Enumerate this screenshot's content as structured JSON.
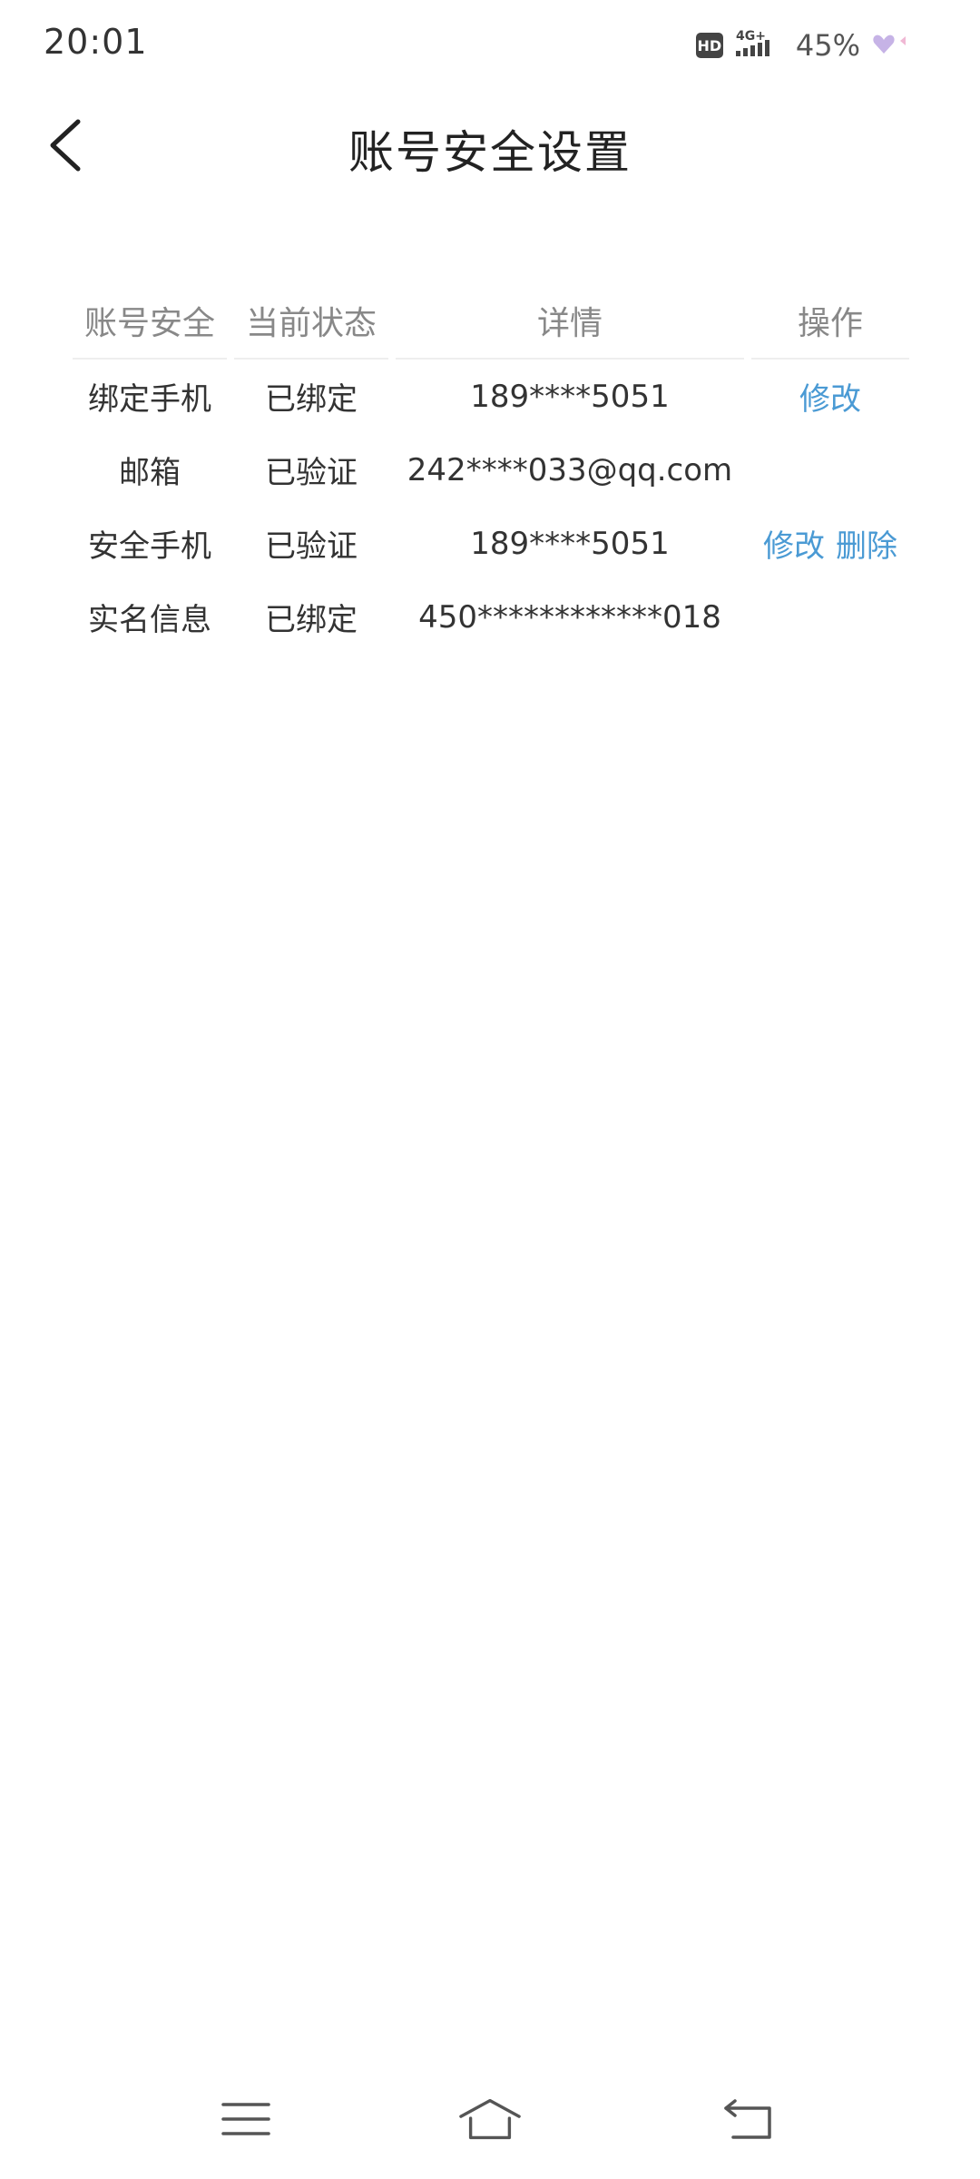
{
  "status_bar": {
    "time": "20:01",
    "hd_label": "HD",
    "network_label": "4G+",
    "battery": "45%"
  },
  "header": {
    "title": "账号安全设置",
    "back_icon": "chevron-left-icon"
  },
  "table": {
    "headers": [
      "账号安全",
      "当前状态",
      "详情",
      "操作"
    ],
    "rows": [
      {
        "item": "绑定手机",
        "status": "已绑定",
        "detail": "189****5051",
        "actions": [
          "修改"
        ]
      },
      {
        "item": "邮箱",
        "status": "已验证",
        "detail": "242****033@qq.com",
        "actions": []
      },
      {
        "item": "安全手机",
        "status": "已验证",
        "detail": "189****5051",
        "actions": [
          "修改",
          "删除"
        ]
      },
      {
        "item": "实名信息",
        "status": "已绑定",
        "detail": "450************018",
        "actions": []
      }
    ]
  },
  "colors": {
    "action": "#4a9ad4",
    "header_text": "#888888",
    "body_text": "#333333"
  },
  "nav_bar": {
    "icons": [
      "menu-icon",
      "home-icon",
      "back-icon"
    ]
  }
}
